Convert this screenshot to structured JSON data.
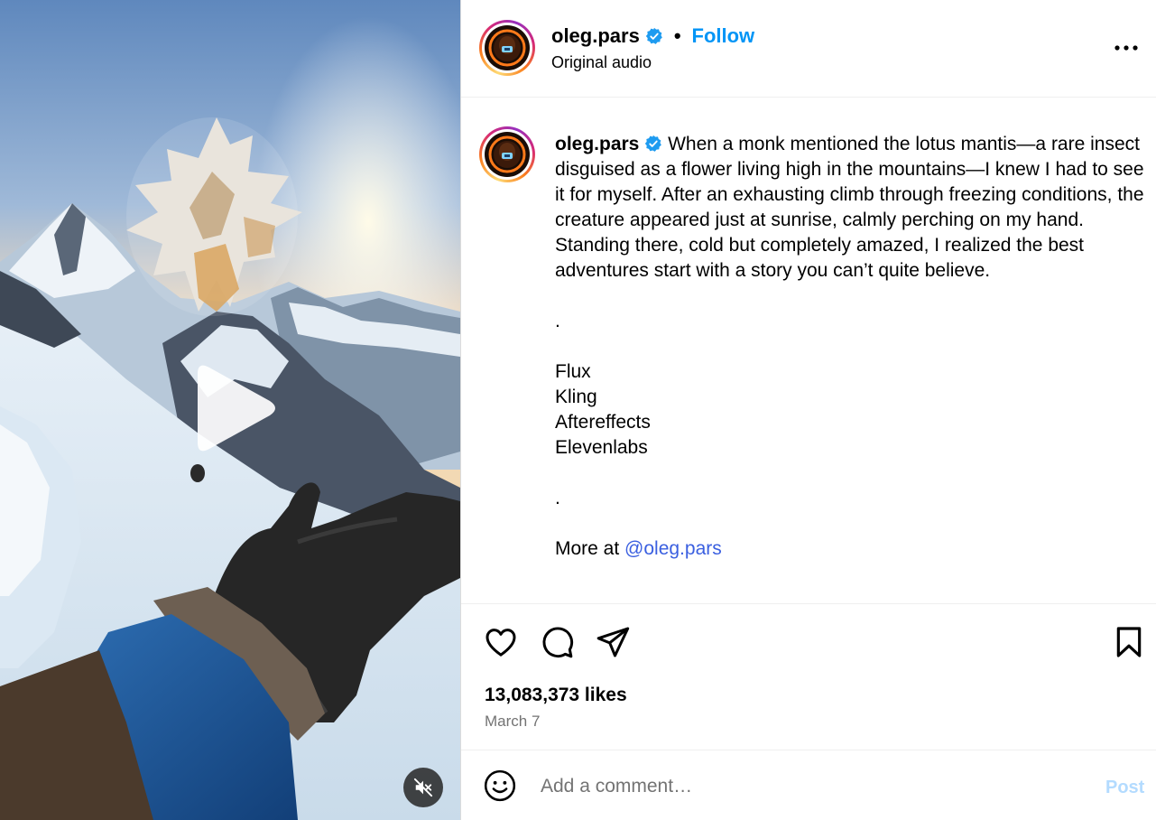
{
  "media": {
    "play_icon": "play-icon",
    "mute_icon": "speaker-muted-icon"
  },
  "header": {
    "username": "oleg.pars",
    "separator": "•",
    "follow_label": "Follow",
    "subtitle": "Original audio",
    "more_icon": "more-horizontal-icon"
  },
  "caption": {
    "username": "oleg.pars",
    "text": "When a monk mentioned the lotus mantis—a rare insect disguised as a flower living high in the mountains—I knew I had to see it for myself. After an exhausting climb through freezing conditions, the creature appeared just at sunrise, calmly perching on my hand. Standing there, cold but completely amazed, I realized the best adventures start with a story you can’t quite believe.",
    "dot1": ".",
    "tools": [
      "Flux",
      "Kling",
      "Aftereffects",
      "Elevenlabs"
    ],
    "dot2": ".",
    "more_prefix": "More at ",
    "mention": "@oleg.pars"
  },
  "actions": {
    "like_icon": "heart-icon",
    "comment_icon": "comment-icon",
    "share_icon": "send-icon",
    "save_icon": "bookmark-icon",
    "likes": "13,083,373 likes",
    "date": "March 7"
  },
  "comment": {
    "emoji_icon": "emoji-icon",
    "placeholder": "Add a comment…",
    "post_label": "Post"
  },
  "colors": {
    "accent": "#0095f6",
    "mention": "#3a5fe0",
    "post_disabled": "#b3dbff",
    "muted_text": "#737373"
  }
}
